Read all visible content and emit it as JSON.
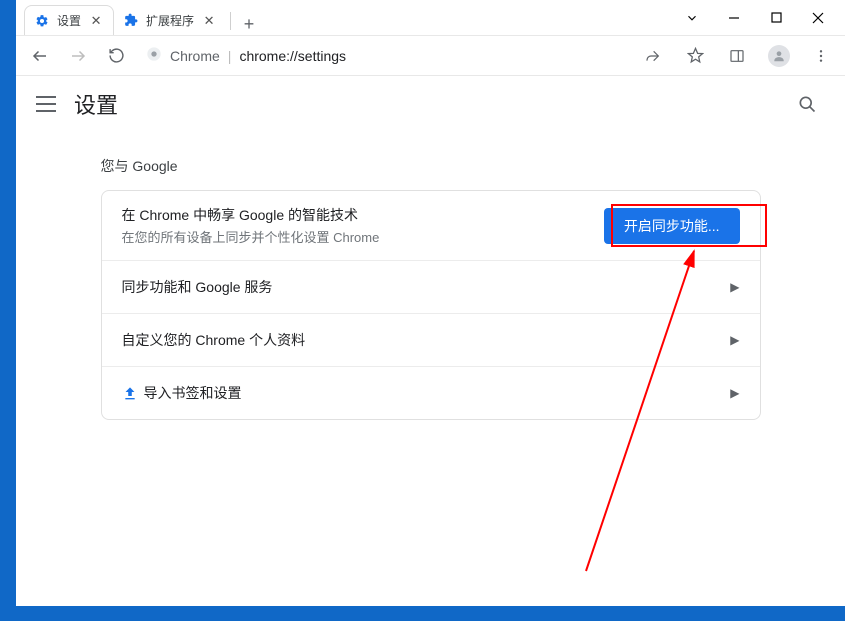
{
  "tabs": [
    {
      "title": "设置",
      "icon": "gear"
    },
    {
      "title": "扩展程序",
      "icon": "puzzle"
    }
  ],
  "omnibox": {
    "scheme": "Chrome",
    "path": "chrome://settings"
  },
  "page": {
    "title": "设置"
  },
  "section": {
    "title": "您与 Google",
    "sync": {
      "title": "在 Chrome 中畅享 Google 的智能技术",
      "subtitle": "在您的所有设备上同步并个性化设置 Chrome",
      "button": "开启同步功能..."
    },
    "rows": [
      "同步功能和 Google 服务",
      "自定义您的 Chrome 个人资料",
      "导入书签和设置"
    ]
  }
}
